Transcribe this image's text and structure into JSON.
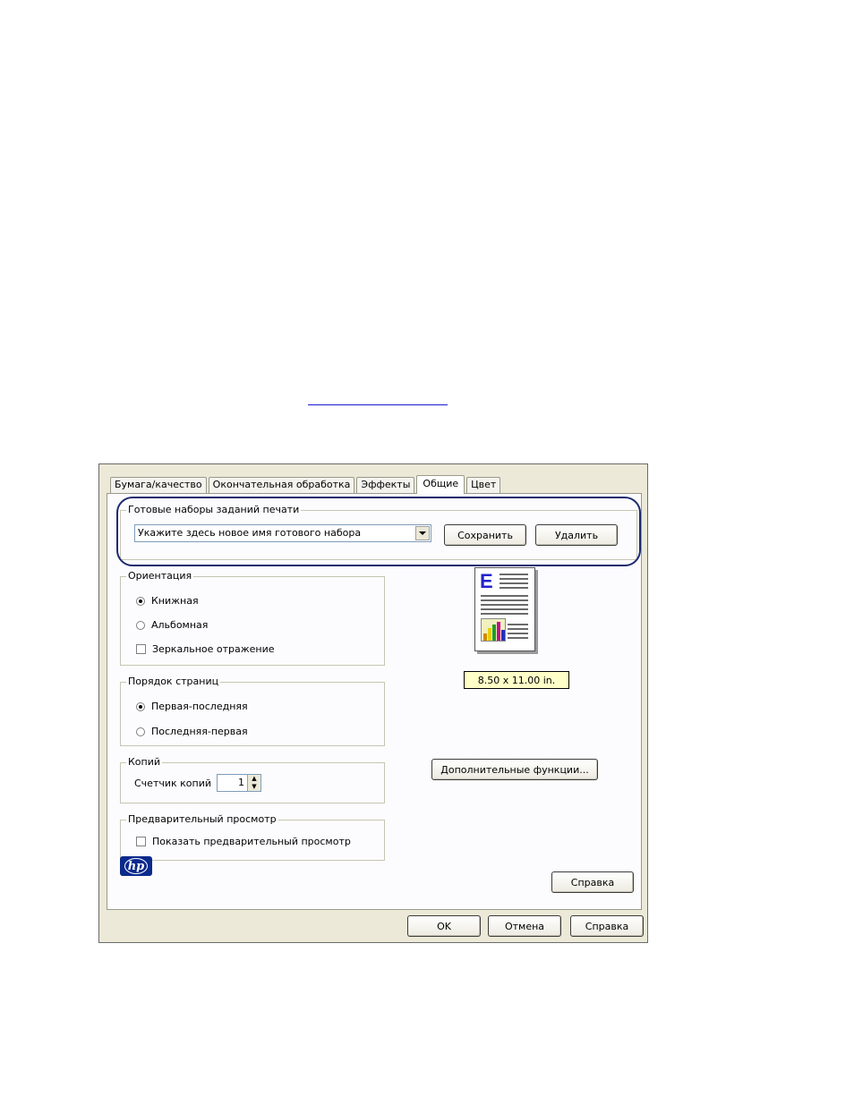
{
  "tabs": [
    {
      "label": "Бумага/качество"
    },
    {
      "label": "Окончательная обработка"
    },
    {
      "label": "Эффекты"
    },
    {
      "label": "Общие"
    },
    {
      "label": "Цвет"
    }
  ],
  "presets": {
    "title": "Готовые наборы заданий печати",
    "input_value": "Укажите здесь новое имя готового набора",
    "save_label": "Сохранить",
    "delete_label": "Удалить"
  },
  "orientation": {
    "title": "Ориентация",
    "portrait": "Книжная",
    "landscape": "Альбомная",
    "mirror": "Зеркальное отражение",
    "selected": "portrait"
  },
  "page_order": {
    "title": "Порядок страниц",
    "first_last": "Первая-последняя",
    "last_first": "Последняя-первая",
    "selected": "first_last"
  },
  "copies": {
    "title": "Копий",
    "counter_label": "Счетчик копий",
    "value": "1"
  },
  "preview_group": {
    "title": "Предварительный просмотр",
    "show_label": "Показать предварительный просмотр"
  },
  "paper_size": "8.50 x 11.00 in.",
  "advanced_button": "Дополнительные функции...",
  "help_button": "Справка",
  "dialog": {
    "ok": "OK",
    "cancel": "Отмена",
    "help": "Справка"
  },
  "colors": {
    "highlight": "#1c2a6e",
    "dialog_bg": "#ece9d8",
    "tooltip_bg": "#ffffc8",
    "hp_blue": "#0a2a8c"
  }
}
